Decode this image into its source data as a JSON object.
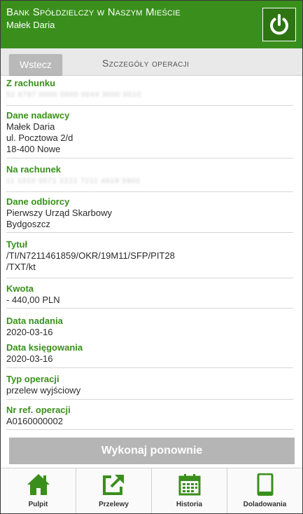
{
  "header": {
    "bank_name": "Bank Spółdzielczy w Naszym Mieście",
    "user_name": "Małek Daria"
  },
  "topbar": {
    "back_label": "Wstecz",
    "title": "Szczegóły operacji"
  },
  "details": {
    "from_account": {
      "label": "Z rachunku",
      "value": "52 8787 0000 0000 0044 3000 0010"
    },
    "sender": {
      "label": "Dane nadawcy",
      "lines": [
        "Małek Daria",
        "ul. Pocztowa 2/d",
        "18-400 Nowe"
      ]
    },
    "to_account": {
      "label": "Na rachunek",
      "value": "11 1010 0071 2222 7211 4618 5900"
    },
    "recipient": {
      "label": "Dane odbiorcy",
      "lines": [
        "Pierwszy Urząd Skarbowy",
        "Bydgoszcz"
      ]
    },
    "title": {
      "label": "Tytuł",
      "lines": [
        "/TI/N7211461859/OKR/19M11/SFP/PIT28",
        "/TXT/kt"
      ]
    },
    "amount": {
      "label": "Kwota",
      "value": "- 440,00 PLN"
    },
    "send_date": {
      "label": "Data nadania",
      "value": "2020-03-16"
    },
    "booking_date": {
      "label": "Data księgowania",
      "value": "2020-03-16"
    },
    "op_type": {
      "label": "Typ operacji",
      "value": "przelew wyjściowy"
    },
    "ref_no": {
      "label": "Nr ref. operacji",
      "value": "A0160000002"
    }
  },
  "actions": {
    "repeat_label": "Wykonaj ponownie"
  },
  "tabs": [
    {
      "label": "Pulpit",
      "icon": "home-icon"
    },
    {
      "label": "Przelewy",
      "icon": "transfer-icon"
    },
    {
      "label": "Historia",
      "icon": "calendar-icon"
    },
    {
      "label": "Doladowania",
      "icon": "phone-icon"
    }
  ],
  "colors": {
    "brand_green": "#3a8f1c",
    "button_gray": "#b5b5b5"
  }
}
